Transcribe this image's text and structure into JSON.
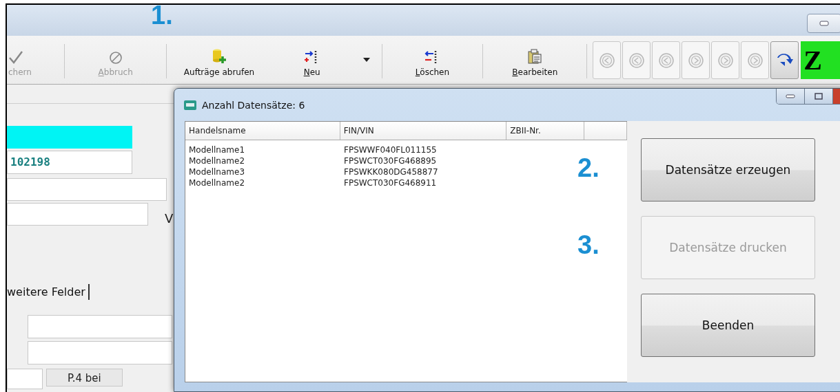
{
  "main_window": {
    "toolbar": [
      {
        "kind": "button",
        "label": "chern",
        "disabled": true,
        "access_key": false
      },
      {
        "kind": "button",
        "label": "Abbruch",
        "disabled": true,
        "access_key": true
      },
      {
        "kind": "button",
        "label": "Aufträge abrufen",
        "disabled": false,
        "access_key": false
      },
      {
        "kind": "button",
        "label": "Neu",
        "disabled": false,
        "access_key": true
      },
      {
        "kind": "dropdown",
        "disabled": false
      },
      {
        "kind": "button",
        "label": "Löschen",
        "disabled": false,
        "access_key": true
      },
      {
        "kind": "button",
        "label": "Bearbeiten",
        "disabled": false,
        "access_key": true
      }
    ],
    "nav_buttons": [
      {
        "kind": "nav",
        "disabled": true
      },
      {
        "kind": "nav",
        "disabled": true
      },
      {
        "kind": "nav",
        "disabled": true
      },
      {
        "kind": "nav",
        "disabled": true
      },
      {
        "kind": "nav",
        "disabled": true
      },
      {
        "kind": "nav",
        "disabled": true
      },
      {
        "kind": "refresh",
        "disabled": false
      }
    ],
    "status_indicator": {
      "text": "Z"
    },
    "form": {
      "fields": [
        {
          "highlighted": true
        },
        {
          "highlighted": false,
          "value": "102198"
        },
        {
          "highlighted": false
        },
        {
          "highlighted": false,
          "label": "V"
        }
      ],
      "section_tab": "weitere Felder",
      "lower_fields": [
        {
          "highlighted": false
        },
        {
          "highlighted": false
        }
      ],
      "bottom_tab": "P.4 bei"
    }
  },
  "dialog": {
    "title": "Anzahl Datensätze: 6",
    "columns": [
      "Handelsname",
      "FIN/VIN",
      "ZBII-Nr."
    ],
    "rows": [
      [
        "Modellname1",
        "FPSWWF040FL011155"
      ],
      [
        "Modellname2",
        "FPSWCT030FG468895"
      ],
      [
        "Modellname3",
        "FPSWKK080DG458877"
      ],
      [
        "Modellname2",
        "FPSWCT030FG468911"
      ]
    ],
    "buttons": [
      {
        "label": "Datensätze erzeugen",
        "disabled": false
      },
      {
        "label": "Datensätze drucken",
        "disabled": true
      },
      {
        "label": "Beenden",
        "disabled": false
      }
    ]
  },
  "annotations": [
    "1.",
    "2.",
    "3."
  ]
}
